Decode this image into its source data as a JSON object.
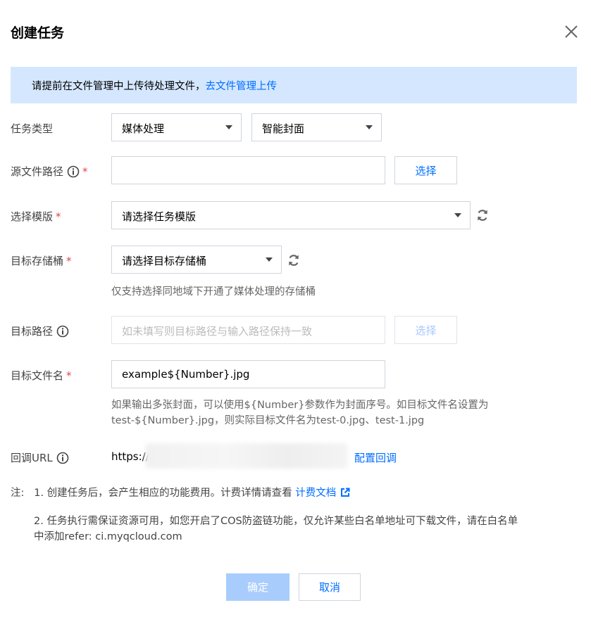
{
  "dialog": {
    "title": "创建任务"
  },
  "banner": {
    "text": "请提前在文件管理中上传待处理文件，",
    "link": "去文件管理上传"
  },
  "task_type": {
    "label": "任务类型",
    "type_value": "媒体处理",
    "subtype_value": "智能封面"
  },
  "source_path": {
    "label": "源文件路径",
    "required_mark": "*",
    "value": "",
    "select_button": "选择"
  },
  "template": {
    "label": "选择模版",
    "required_mark": "*",
    "value": "请选择任务模版"
  },
  "target_bucket": {
    "label": "目标存储桶",
    "required_mark": "*",
    "value": "请选择目标存储桶",
    "hint": "仅支持选择同地域下开通了媒体处理的存储桶"
  },
  "target_path": {
    "label": "目标路径",
    "placeholder": "如未填写则目标路径与输入路径保持一致",
    "select_button": "选择"
  },
  "target_filename": {
    "label": "目标文件名",
    "required_mark": "*",
    "value": "example${Number}.jpg",
    "hint_line1": "如果输出多张封面，可以使用${Number}参数作为封面序号。如目标文件名设置为",
    "hint_line2": "test-${Number}.jpg，则实际目标文件名为test-0.jpg、test-1.jpg"
  },
  "callback": {
    "label": "回调URL",
    "url_prefix": "https://",
    "config_link": "配置回调"
  },
  "notes": {
    "prefix": "注:",
    "note1_text": "1. 创建任务后，会产生相应的功能费用。计费详情请查看",
    "note1_link": "计费文档",
    "note2_line1": "2. 任务执行需保证资源可用，如您开启了COS防盗链功能，仅允许某些白名单地址可下载文件，请在白名单",
    "note2_line2": "中添加refer: ci.myqcloud.com"
  },
  "footer": {
    "confirm": "确定",
    "cancel": "取消"
  },
  "colors": {
    "primary": "#006eff",
    "banner_bg": "#d5e7ff",
    "required": "#e54545",
    "disabled_button": "#a8cdfd"
  }
}
